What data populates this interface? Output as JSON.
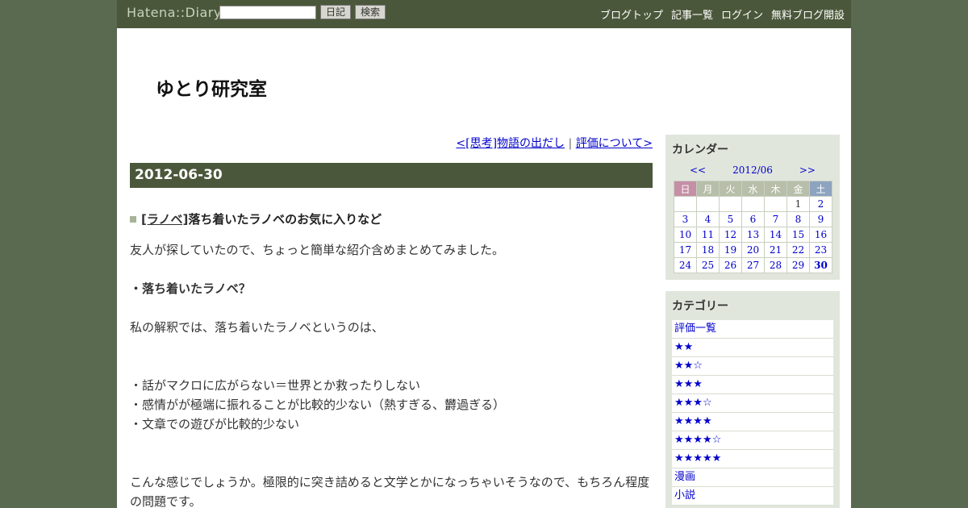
{
  "header": {
    "logo": "Hatena::Diary",
    "search_placeholder": "",
    "diary_button": "日記",
    "search_button": "検索",
    "nav": [
      "ブログトップ",
      "記事一覧",
      "ログイン",
      "無料ブログ開設"
    ]
  },
  "blog": {
    "title": "ゆとり研究室"
  },
  "pager": {
    "prev": "<[思考]物語の出だし",
    "sep": " | ",
    "next": "評価について>"
  },
  "entry": {
    "date": "2012-06-30",
    "category": "[ラノベ]",
    "title": "落ち着いたラノベのお気に入りなど",
    "p1": "友人が探していたので、ちょっと簡単な紹介含めまとめてみました。",
    "p2": "・落ち着いたラノベ？",
    "p3": "私の解釈では、落ち着いたラノベというのは、",
    "list": [
      "・話がマクロに広がらない＝世界とか救ったりしない",
      "・感情がが極端に振れることが比較的少ない（熱すぎる、欝過ぎる）",
      "・文章での遊びが比較的少ない"
    ],
    "p4": "こんな感じでしょうか。極限的に突き詰めると文学とかになっちゃいそうなので、もちろん程度の問題です。"
  },
  "calendar": {
    "title": "カレンダー",
    "prev": "<<",
    "month": "2012/06",
    "next": ">>",
    "weekdays": [
      "日",
      "月",
      "火",
      "水",
      "木",
      "金",
      "土"
    ],
    "weeks": [
      [
        "",
        "",
        "",
        "",
        "",
        "1",
        "2"
      ],
      [
        "3",
        "4",
        "5",
        "6",
        "7",
        "8",
        "9"
      ],
      [
        "10",
        "11",
        "12",
        "13",
        "14",
        "15",
        "16"
      ],
      [
        "17",
        "18",
        "19",
        "20",
        "21",
        "22",
        "23"
      ],
      [
        "24",
        "25",
        "26",
        "27",
        "28",
        "29",
        "30"
      ]
    ]
  },
  "categories": {
    "title": "カテゴリー",
    "items": [
      "評価一覧",
      "★★",
      "★★☆",
      "★★★",
      "★★★☆",
      "★★★★",
      "★★★★☆",
      "★★★★★",
      "漫画",
      "小説"
    ]
  }
}
